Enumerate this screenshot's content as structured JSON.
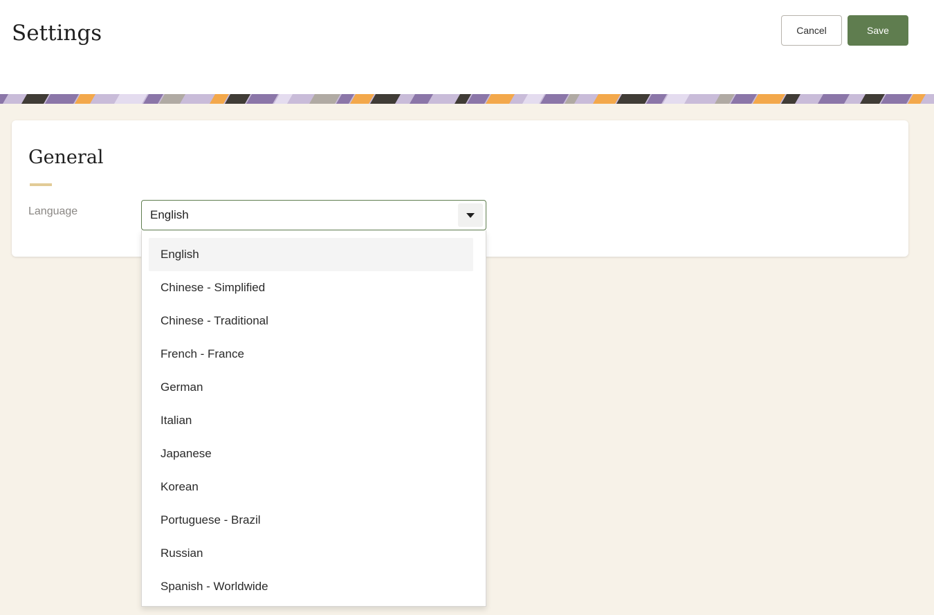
{
  "header": {
    "title": "Settings",
    "cancel_label": "Cancel",
    "save_label": "Save"
  },
  "section": {
    "title": "General"
  },
  "language": {
    "label": "Language",
    "selected": "English",
    "options": [
      "English",
      "Chinese - Simplified",
      "Chinese - Traditional",
      "French - France",
      "German",
      "Italian",
      "Japanese",
      "Korean",
      "Portuguese - Brazil",
      "Russian",
      "Spanish - Worldwide"
    ],
    "highlighted_index": 0
  },
  "colors": {
    "primary": "#5f7d4f",
    "background": "#f7f2e8",
    "accent": "#e2cb96",
    "banner_purple": "#8b76a8",
    "banner_lilac": "#c9bcd9",
    "banner_orange": "#f3a84b",
    "banner_dark": "#403c36"
  },
  "icons": {
    "dropdown_arrow": "caret-down-icon",
    "banner": "decorative-pattern"
  }
}
